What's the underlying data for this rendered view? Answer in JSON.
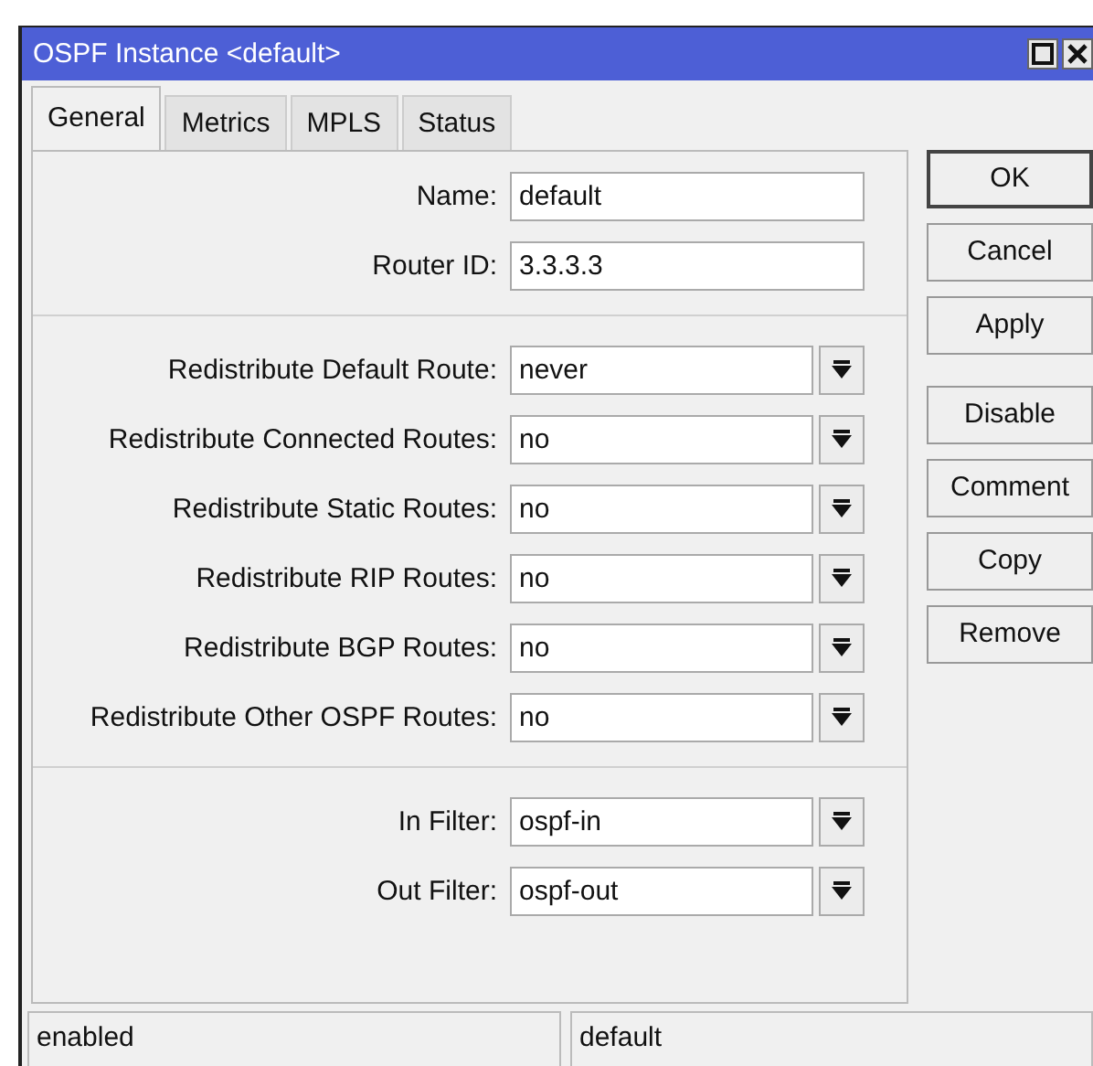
{
  "window": {
    "title": "OSPF Instance <default>"
  },
  "tabs": [
    {
      "label": "General",
      "selected": true
    },
    {
      "label": "Metrics",
      "selected": false
    },
    {
      "label": "MPLS",
      "selected": false
    },
    {
      "label": "Status",
      "selected": false
    }
  ],
  "groups": [
    [
      {
        "kind": "text",
        "label": "Name:",
        "value": "default"
      },
      {
        "kind": "text",
        "label": "Router ID:",
        "value": "3.3.3.3"
      }
    ],
    [
      {
        "kind": "dropdown",
        "label": "Redistribute Default Route:",
        "value": "never"
      },
      {
        "kind": "dropdown",
        "label": "Redistribute Connected Routes:",
        "value": "no"
      },
      {
        "kind": "dropdown",
        "label": "Redistribute Static Routes:",
        "value": "no"
      },
      {
        "kind": "dropdown",
        "label": "Redistribute RIP Routes:",
        "value": "no"
      },
      {
        "kind": "dropdown",
        "label": "Redistribute BGP Routes:",
        "value": "no"
      },
      {
        "kind": "dropdown",
        "label": "Redistribute Other OSPF Routes:",
        "value": "no"
      }
    ],
    [
      {
        "kind": "dropdown",
        "label": "In Filter:",
        "value": "ospf-in"
      },
      {
        "kind": "dropdown",
        "label": "Out Filter:",
        "value": "ospf-out"
      }
    ]
  ],
  "buttons": [
    [
      "OK",
      "Cancel",
      "Apply"
    ],
    [
      "Disable",
      "Comment",
      "Copy",
      "Remove"
    ]
  ],
  "status_bar": [
    "enabled",
    "default"
  ]
}
